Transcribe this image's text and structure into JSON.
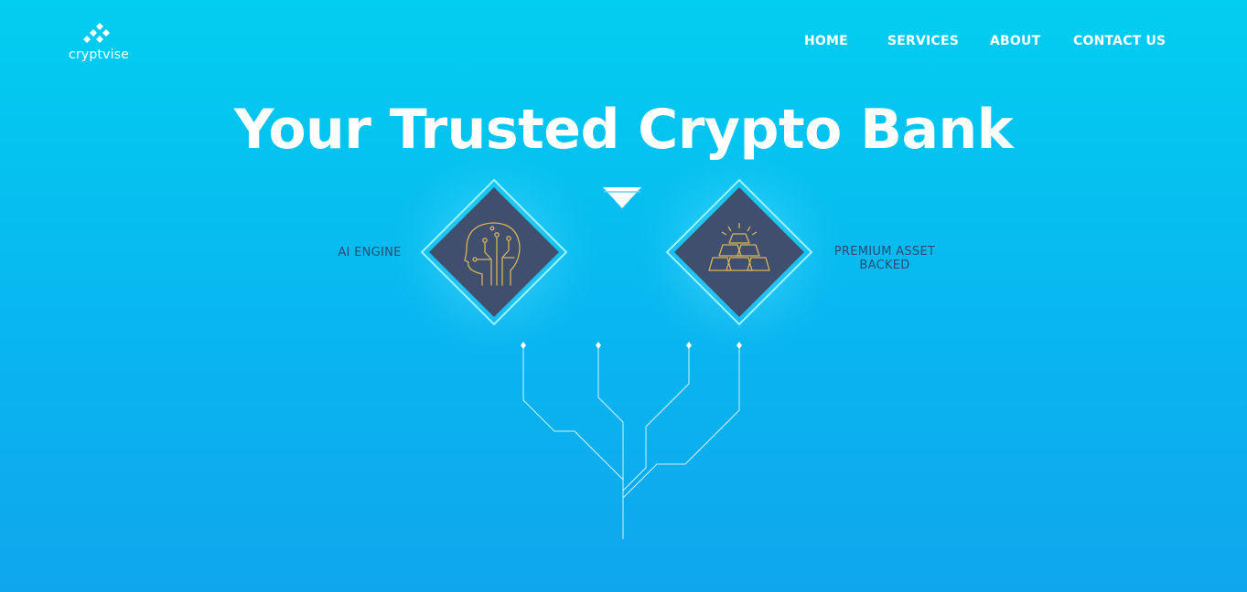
{
  "brand": {
    "name": "cryptvise"
  },
  "nav": {
    "items": [
      {
        "label": "HOME"
      },
      {
        "label": "SERVICES"
      },
      {
        "label": "ABOUT"
      },
      {
        "label": "CONTACT US"
      }
    ]
  },
  "hero": {
    "title": "Your Trusted Crypto Bank"
  },
  "features": [
    {
      "label": "AI ENGINE",
      "icon": "ai-head-icon"
    },
    {
      "label_line1": "PREMIUM ASSET",
      "label_line2": "BACKED",
      "icon": "gold-bars-icon"
    }
  ],
  "colors": {
    "background_top": "#02cef0",
    "background_bottom": "#0fa6ee",
    "diamond_fill": "#404f6e",
    "icon_gold": "#d8b35a",
    "label_text": "#2e4a72",
    "white": "#ffffff"
  }
}
